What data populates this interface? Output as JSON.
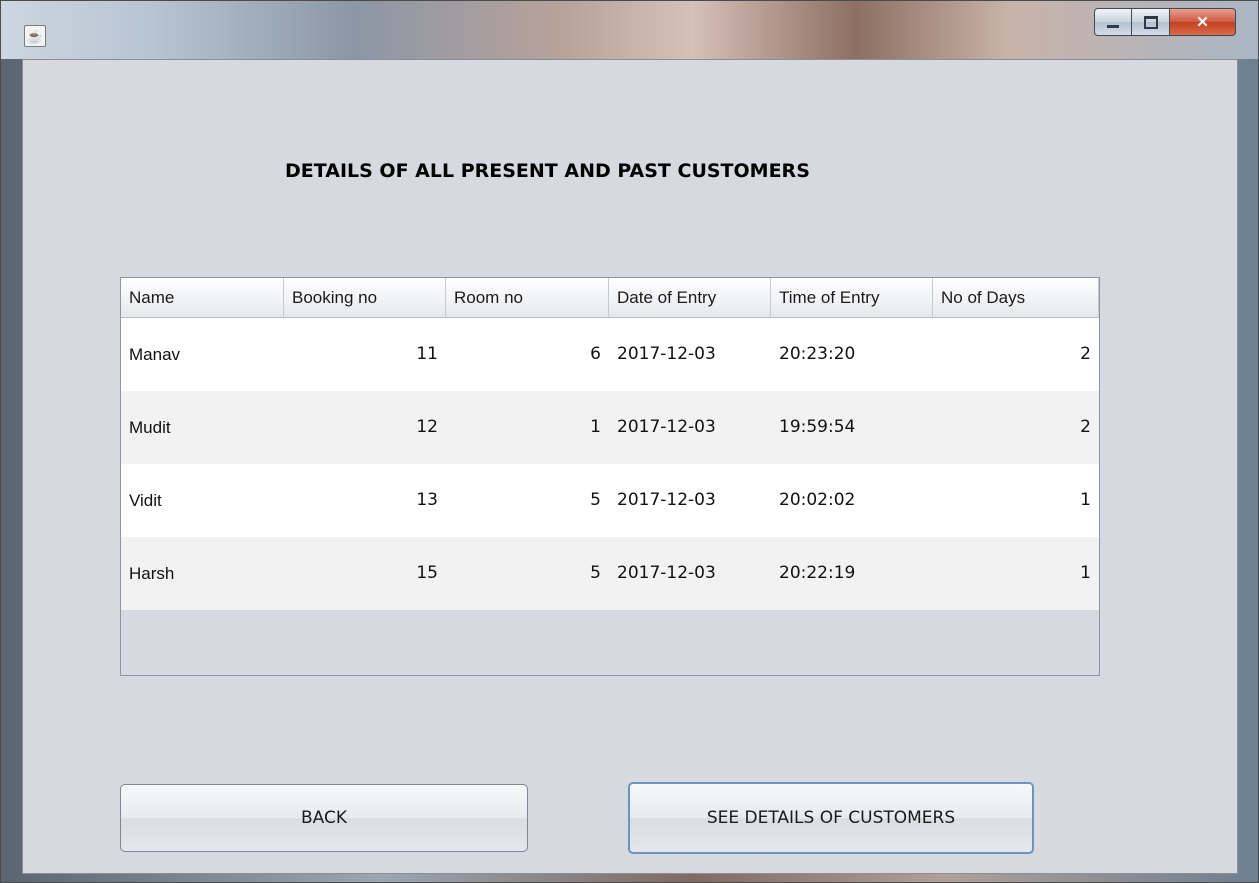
{
  "window": {
    "icon_glyph": "☕",
    "controls": {
      "minimize": "minimize",
      "maximize": "maximize",
      "close": "✕"
    }
  },
  "heading": "DETAILS OF ALL PRESENT AND PAST CUSTOMERS",
  "table": {
    "columns": [
      "Name",
      "Booking no",
      "Room no",
      "Date of Entry",
      "Time of Entry",
      "No of Days"
    ],
    "rows": [
      [
        "Manav",
        "11",
        "6",
        "2017-12-03",
        "20:23:20",
        "2"
      ],
      [
        "Mudit",
        "12",
        "1",
        "2017-12-03",
        "19:59:54",
        "2"
      ],
      [
        "Vidit",
        "13",
        "5",
        "2017-12-03",
        "20:02:02",
        "1"
      ],
      [
        "Harsh",
        "15",
        "5",
        "2017-12-03",
        "20:22:19",
        "1"
      ]
    ]
  },
  "buttons": {
    "back": "BACK",
    "see_details": "SEE DETAILS OF CUSTOMERS"
  }
}
